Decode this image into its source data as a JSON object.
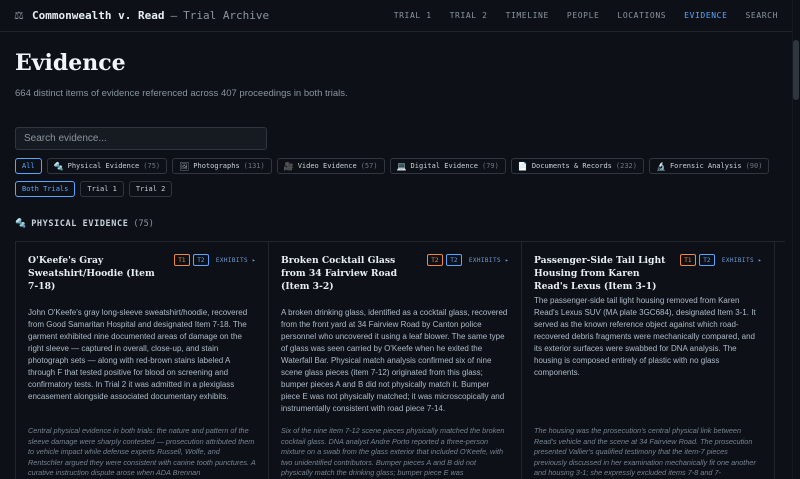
{
  "header": {
    "title": "Commonwealth v. Read",
    "separator": "—",
    "subtitle": "Trial Archive",
    "nav": [
      "TRIAL 1",
      "TRIAL 2",
      "TIMELINE",
      "PEOPLE",
      "LOCATIONS",
      "EVIDENCE",
      "SEARCH"
    ],
    "active_nav": "EVIDENCE"
  },
  "page": {
    "title": "Evidence",
    "subtitle": "664 distinct items of evidence referenced across 407 proceedings in both trials."
  },
  "search": {
    "placeholder": "Search evidence..."
  },
  "filters": [
    {
      "icon": "",
      "label": "All",
      "count": ""
    },
    {
      "icon": "🔩",
      "label": "Physical Evidence",
      "count": "(75)"
    },
    {
      "icon": "🖼",
      "label": "Photographs",
      "count": "(131)"
    },
    {
      "icon": "🎥",
      "label": "Video Evidence",
      "count": "(57)"
    },
    {
      "icon": "💻",
      "label": "Digital Evidence",
      "count": "(79)"
    },
    {
      "icon": "📄",
      "label": "Documents & Records",
      "count": "(232)"
    },
    {
      "icon": "🔬",
      "label": "Forensic Analysis",
      "count": "(90)"
    }
  ],
  "trial_filters": [
    "Both Trials",
    "Trial 1",
    "Trial 2"
  ],
  "section": {
    "icon": "🔩",
    "name": "PHYSICAL EVIDENCE",
    "count": "(75)"
  },
  "cards": [
    {
      "title": "O'Keefe's Gray Sweatshirt/Hoodie (Item 7-18)",
      "tags": [
        "T1",
        "T2"
      ],
      "exhibits": "EXHIBITS ▸",
      "body": "John O'Keefe's gray long-sleeve sweatshirt/hoodie, recovered from Good Samaritan Hospital and designated Item 7-18. The garment exhibited nine documented areas of damage on the right sleeve — captured in overall, close-up, and stain photograph sets — along with red-brown stains labeled A through F that tested positive for blood on screening and confirmatory tests. In Trial 2 it was admitted in a plexiglass encasement alongside associated documentary exhibits.",
      "note": "Central physical evidence in both trials: the nature and pattern of the sleeve damage were sharply contested — prosecution attributed them to vehicle impact while defense experts Russell, Wolfe, and Rentschler argued they were consistent with canine tooth punctures. A curative instruction dispute arose when ADA Brennan"
    },
    {
      "title": "Broken Cocktail Glass from 34 Fairview Road (Item 3-2)",
      "tags": [
        "T2",
        "T2"
      ],
      "exhibits": "EXHIBITS ▸",
      "body": "A broken drinking glass, identified as a cocktail glass, recovered from the front yard at 34 Fairview Road by Canton police personnel who uncovered it using a leaf blower. The same type of glass was seen carried by O'Keefe when he exited the Waterfall Bar. Physical match analysis confirmed six of nine scene glass pieces (item 7-12) originated from this glass; bumper pieces A and B did not physically match it. Bumper piece E was not physically matched; it was microscopically and instrumentally consistent with road piece 7-14.",
      "note": "Six of the nine item 7-12 scene pieces physically matched the broken cocktail glass. DNA analyst Andre Porto reported a three-person mixture on a swab from the glass exterior that included O'Keefe, with two unidentified contributors. Bumper pieces A and B did not physically match the drinking glass; bumper piece E was"
    },
    {
      "title": "Passenger-Side Tail Light Housing from Karen Read's Lexus (Item 3-1)",
      "tags": [
        "T1",
        "T2"
      ],
      "exhibits": "EXHIBITS ▸",
      "body": "The passenger-side tail light housing removed from Karen Read's Lexus SUV (MA plate 3GC684), designated Item 3-1. It served as the known reference object against which road-recovered debris fragments were mechanically compared, and its exterior surfaces were swabbed for DNA analysis. The housing is composed entirely of plastic with no glass components.",
      "note": "The housing was the prosecution's central physical link between Read's vehicle and the scene at 34 Fairview Road. The prosecution presented Vallier's qualified testimony that the item-7 pieces previously discussed in her examination mechanically fit one another and housing 3-1; she expressly excluded items 7-8 and 7-"
    }
  ]
}
